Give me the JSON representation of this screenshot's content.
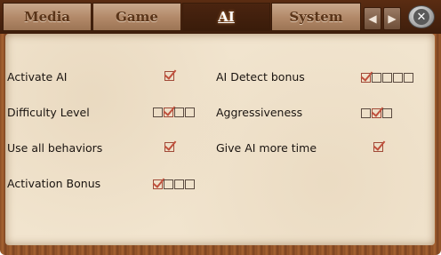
{
  "tabs": [
    {
      "label": "Media",
      "active": false
    },
    {
      "label": "Game",
      "active": false
    },
    {
      "label": "AI",
      "active": true
    },
    {
      "label": "System",
      "active": false
    }
  ],
  "nav": {
    "prev_icon": "arrow-left-icon",
    "next_icon": "arrow-right-icon",
    "close_icon": "close-icon"
  },
  "settings": {
    "activate_ai": {
      "label": "Activate AI",
      "options": 1,
      "selected": 1
    },
    "difficulty_level": {
      "label": "Difficulty Level",
      "options": 4,
      "selected": 2
    },
    "use_all_behaviors": {
      "label": "Use all behaviors",
      "options": 1,
      "selected": 1
    },
    "activation_bonus": {
      "label": "Activation Bonus",
      "options": 4,
      "selected": 1
    },
    "ai_detect_bonus": {
      "label": "AI Detect bonus",
      "options": 5,
      "selected": 1
    },
    "aggressiveness": {
      "label": "Aggressiveness",
      "options": 3,
      "selected": 2
    },
    "give_ai_more_time": {
      "label": "Give AI more time",
      "options": 1,
      "selected": 1
    }
  },
  "colors": {
    "frame": "#8a4e26",
    "panel": "#f1e4ce",
    "check": "#c0503c",
    "active_tab": "#3a1c0a"
  }
}
